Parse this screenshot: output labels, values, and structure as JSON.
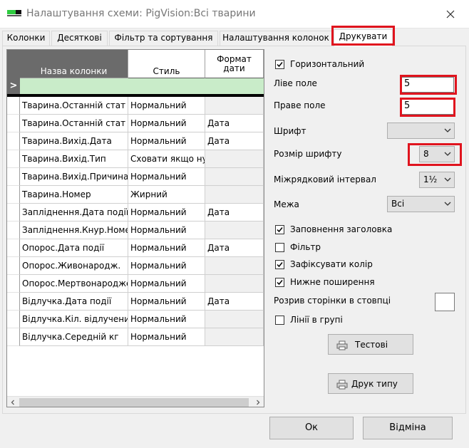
{
  "window": {
    "title": "Налаштування схеми: PigVision:Всі тварини",
    "close_icon": "close-icon"
  },
  "tabs": [
    {
      "label": "Колонки",
      "active": false
    },
    {
      "label": "Десяткові",
      "active": false
    },
    {
      "label": "Фільтр та сортування",
      "active": false
    },
    {
      "label": "Налаштування колонок",
      "active": false
    },
    {
      "label": "Друкувати",
      "active": true
    }
  ],
  "grid": {
    "headers": [
      "Назва колонки",
      "Стиль",
      "Формат дати"
    ],
    "new_row_marker": ">",
    "rows": [
      [
        "Тварина.Останній стат",
        "Нормальний",
        ""
      ],
      [
        "Тварина.Останній стат",
        "Нормальний",
        "Дата"
      ],
      [
        "Тварина.Вихід.Дата",
        "Нормальний",
        "Дата"
      ],
      [
        "Тварина.Вихід.Тип",
        "Сховати якщо нуль",
        ""
      ],
      [
        "Тварина.Вихід.Причина",
        "Нормальний",
        ""
      ],
      [
        "Тварина.Номер",
        "Жирний",
        ""
      ],
      [
        "Запліднення.Дата події",
        "Нормальний",
        "Дата"
      ],
      [
        "Запліднення.Кнур.Номер",
        "Нормальний",
        ""
      ],
      [
        "Опорос.Дата події",
        "Нормальний",
        "Дата"
      ],
      [
        "Опорос.Живонародж.",
        "Нормальний",
        ""
      ],
      [
        "Опорос.Мертвонароджені",
        "Нормальний",
        ""
      ],
      [
        "Відлучка.Дата події",
        "Нормальний",
        "Дата"
      ],
      [
        "Відлучка.Кіл. відлучених",
        "Нормальний",
        ""
      ],
      [
        "Відлучка.Середній кг",
        "Нормальний",
        ""
      ]
    ]
  },
  "print": {
    "horizontal": {
      "label": "Горизонтальний",
      "checked": true
    },
    "left_margin": {
      "label": "Ліве поле",
      "value": "5"
    },
    "right_margin": {
      "label": "Праве поле",
      "value": "5"
    },
    "font": {
      "label": "Шрифт",
      "value": ""
    },
    "font_size": {
      "label": "Розмір шрифту",
      "value": "8"
    },
    "line_spacing": {
      "label": "Міжрядковий інтервал",
      "value": "1½"
    },
    "border": {
      "label": "Межа",
      "value": "Всі"
    },
    "fill_header": {
      "label": "Заповнення заголовка",
      "checked": true
    },
    "filter": {
      "label": "Фільтр",
      "checked": false
    },
    "fix_color": {
      "label": "Зафіксувати колір",
      "checked": true
    },
    "bottom_ext": {
      "label": "Нижне поширення",
      "checked": true
    },
    "page_break": {
      "label": "Розрив сторінки в стовпці"
    },
    "group_lines": {
      "label": "Лінії в групі",
      "checked": false
    },
    "test_button": "Тестові",
    "print_type_button": "Друк типу"
  },
  "footer": {
    "ok": "Ок",
    "cancel": "Відміна"
  },
  "colors": {
    "highlight": "#e0141e",
    "new_row": "#c9ecc9",
    "header_dark": "#6b6b6b"
  }
}
